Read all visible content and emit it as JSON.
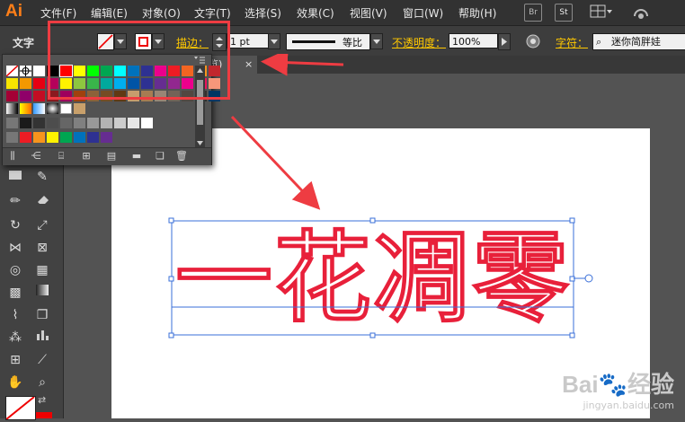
{
  "app": {
    "logo": "Ai"
  },
  "menu": [
    "文件(F)",
    "编辑(E)",
    "对象(O)",
    "文字(T)",
    "选择(S)",
    "效果(C)",
    "视图(V)",
    "窗口(W)",
    "帮助(H)"
  ],
  "top_icons": {
    "br": "Br",
    "st": "St"
  },
  "control": {
    "context_label": "文字",
    "stroke_label": "描边：",
    "stroke_weight": "1 pt",
    "profile_label": "等比",
    "opacity_label": "不透明度：",
    "opacity_value": "100%",
    "char_label": "字符：",
    "font_name": "迷你简胖娃"
  },
  "document": {
    "tab_label": "览)",
    "close_glyph": "×"
  },
  "artwork": {
    "text": "一花凋零",
    "stroke_color": "#e8203a"
  },
  "annotation": {
    "box_color": "#ee3c42",
    "arrow_color": "#ee3c42"
  },
  "swatches": {
    "row1": [
      "#ff0000",
      "#ffff00",
      "#00ff00",
      "#00a651",
      "#00ffff",
      "#0072bc",
      "#2e3192",
      "#ec008c",
      "#ed1c24",
      "#f26522",
      "#f7941d",
      "#c1272d"
    ],
    "row2": [
      "#fff200",
      "#8dc63f",
      "#39b54a",
      "#00a99d",
      "#00aeef",
      "#0054a6",
      "#2e3192",
      "#662d91",
      "#92278f",
      "#ec008c",
      "#ed145b",
      "#f7977a"
    ],
    "row3": [
      "#9e005d",
      "#a0410d",
      "#8c6239",
      "#754c24",
      "#603913",
      "#c69c6d",
      "#a67c52",
      "#998675",
      "#736357",
      "#534741",
      "#362f2d",
      "#003663"
    ],
    "row4": [
      "#1a1a1a",
      "#333333",
      "#4d4d4d",
      "#666666",
      "#808080",
      "#999999",
      "#b3b3b3",
      "#cccccc",
      "#e6e6e6",
      "#ffffff"
    ],
    "row5": [
      "#ed1c24",
      "#f7941d",
      "#fff200",
      "#00a651",
      "#0072bc",
      "#2e3192",
      "#662d91"
    ]
  },
  "watermark": {
    "brand": "Bai",
    "brand2": "经验",
    "url": "jingyan.baidu.com"
  }
}
